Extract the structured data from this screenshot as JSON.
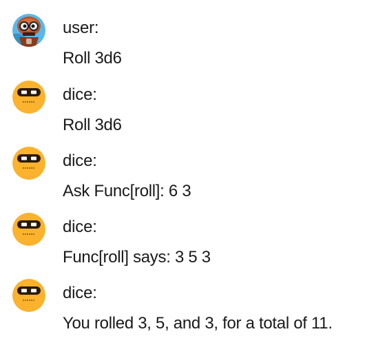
{
  "messages": [
    {
      "sender": "user:",
      "text": "Roll 3d6",
      "avatar": "robot-avatar-icon"
    },
    {
      "sender": "dice:",
      "text": "Roll 3d6",
      "avatar": "dice-bot-avatar-icon"
    },
    {
      "sender": "dice:",
      "text": "Ask Func[roll]: 6 3",
      "avatar": "dice-bot-avatar-icon"
    },
    {
      "sender": "dice:",
      "text": "Func[roll] says: 3 5 3",
      "avatar": "dice-bot-avatar-icon"
    },
    {
      "sender": "dice:",
      "text": "You rolled 3, 5, and 3, for a total of 11.",
      "avatar": "dice-bot-avatar-icon"
    }
  ],
  "colors": {
    "dice_avatar_bg": "#fbb22d",
    "dice_avatar_band": "#2a1a0a",
    "user_avatar_bg": "#5ab7e8"
  }
}
